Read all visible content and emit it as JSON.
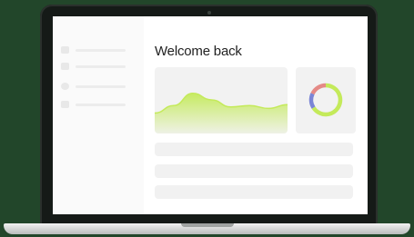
{
  "screen": {
    "title": "Welcome back",
    "sidebar": {
      "items": [
        {
          "icon": "square-icon"
        },
        {
          "icon": "square-icon"
        },
        {
          "icon": "circle-icon"
        },
        {
          "icon": "square-icon"
        }
      ]
    },
    "area_chart": {
      "type": "area",
      "values": [
        0.22,
        0.38,
        0.64,
        0.5,
        0.35,
        0.38,
        0.32,
        0.4
      ],
      "color": "#c4ea5a"
    },
    "donut_chart": {
      "type": "pie",
      "segments": [
        {
          "value": 0.66,
          "color": "#c4ea5a"
        },
        {
          "value": 0.16,
          "color": "#7b85d6"
        },
        {
          "value": 0.18,
          "color": "#e58a86"
        }
      ]
    },
    "list_rows": 3
  },
  "colors": {
    "background": "#22462a",
    "accent": "#c4ea5a"
  }
}
